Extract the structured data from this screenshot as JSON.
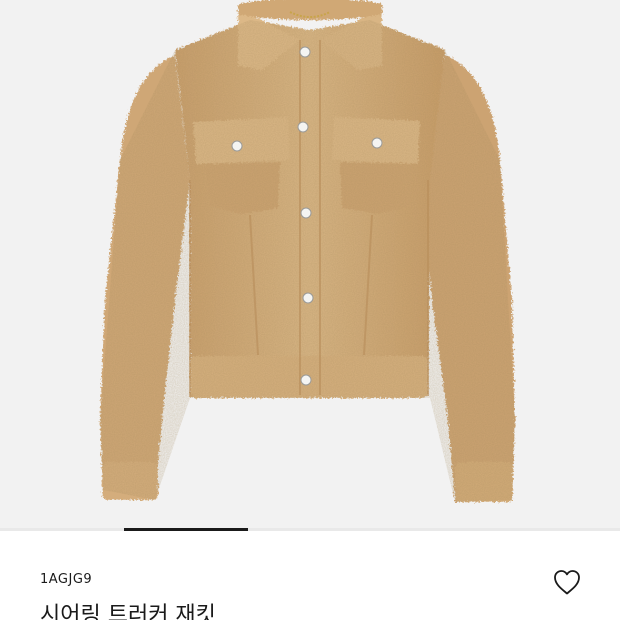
{
  "product": {
    "sku": "1AGJG9",
    "name": "시어링 트러커 재킷",
    "image_icon": "shearling-trucker-jacket-image"
  },
  "carousel": {
    "active_index": 1,
    "total": 5
  },
  "wishlist": {
    "icon": "heart-outline-icon"
  },
  "colors": {
    "background": "#f2f2f2",
    "jacket": "#d2ad7c",
    "indicator": "#1a1a1a",
    "text": "#1a1a1a"
  }
}
